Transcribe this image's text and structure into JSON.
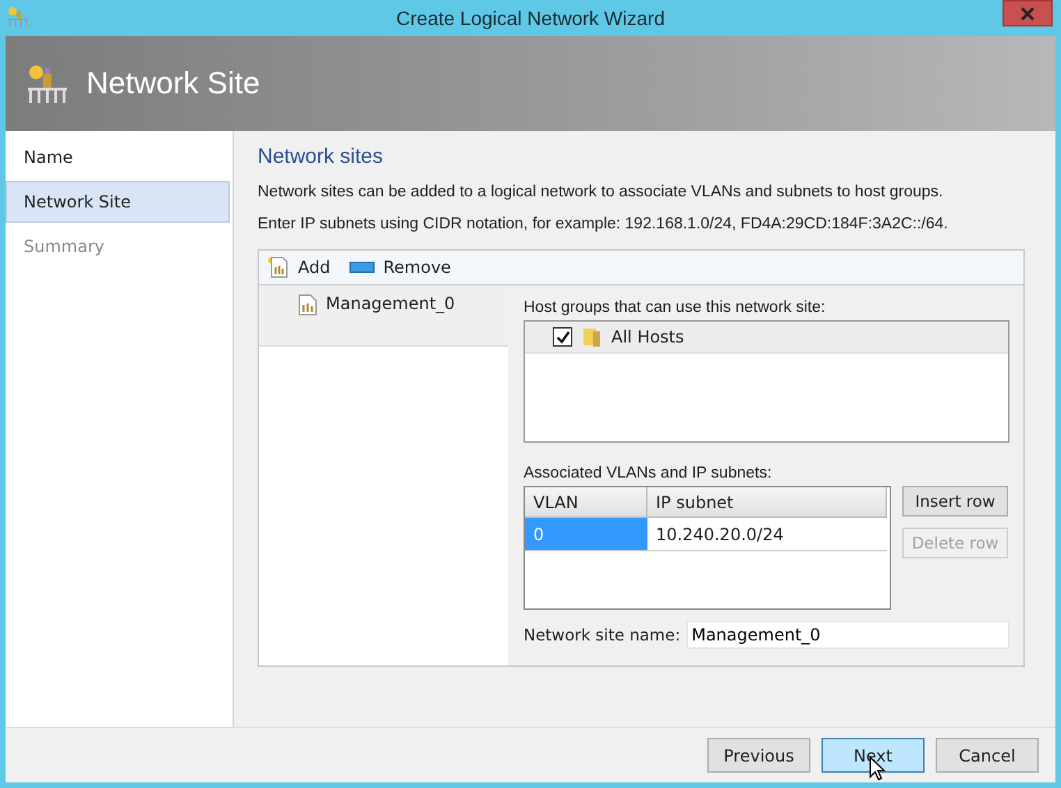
{
  "window": {
    "title": "Create Logical Network Wizard"
  },
  "header": {
    "title": "Network Site"
  },
  "steps": [
    {
      "label": "Name",
      "selected": false,
      "disabled": false
    },
    {
      "label": "Network Site",
      "selected": true,
      "disabled": false
    },
    {
      "label": "Summary",
      "selected": false,
      "disabled": true
    }
  ],
  "section": {
    "heading": "Network sites",
    "description": "Network sites can be added to a logical network to associate VLANs and subnets to host groups.",
    "hint": "Enter IP subnets using CIDR notation, for example: 192.168.1.0/24, FD4A:29CD:184F:3A2C::/64."
  },
  "toolbar": [
    {
      "label": "Add",
      "kind": "add"
    },
    {
      "label": "Remove",
      "kind": "remove"
    }
  ],
  "sites": [
    {
      "label": "Management_0",
      "selected": true
    }
  ],
  "host_groups": {
    "label": "Host groups that can use this network site:",
    "items": [
      {
        "label": "All Hosts",
        "checked": true
      }
    ]
  },
  "subnets": {
    "label": "Associated VLANs and IP subnets:",
    "columns": [
      "VLAN",
      "IP subnet"
    ],
    "rows": [
      {
        "vlan": "0",
        "subnet": "10.240.20.0/24",
        "selected": true
      }
    ],
    "buttons": [
      {
        "label": "Insert row",
        "disabled": false
      },
      {
        "label": "Delete row",
        "disabled": true
      }
    ]
  },
  "site_name": {
    "label": "Network site name:",
    "value": "Management_0"
  },
  "footer_buttons": [
    {
      "label": "Previous",
      "hovered": false
    },
    {
      "label": "Next",
      "hovered": true
    },
    {
      "label": "Cancel",
      "hovered": false
    }
  ]
}
